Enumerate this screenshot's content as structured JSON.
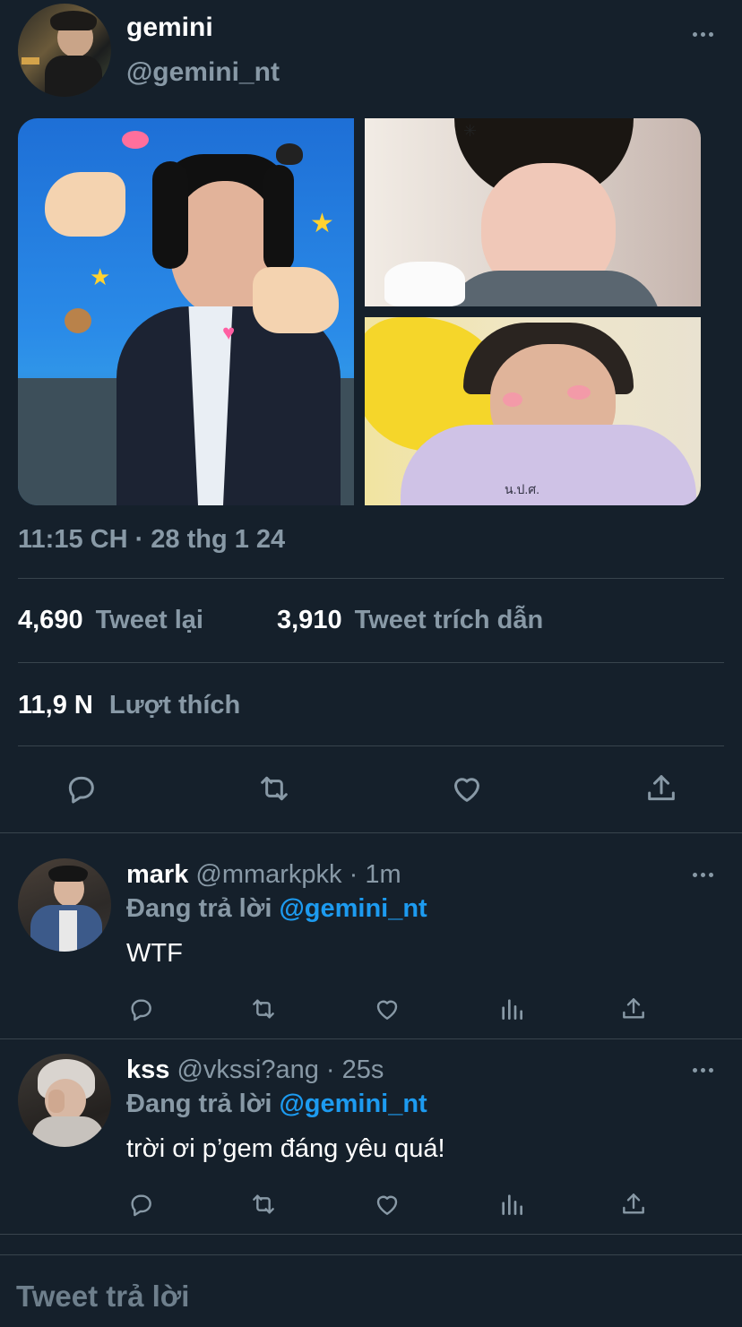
{
  "tweet": {
    "author_name": "gemini",
    "author_handle": "@gemini_nt",
    "timestamp": "11:15 CH · 28 thg 1 24",
    "stats": {
      "retweets_count": "4,690",
      "retweets_label": "Tweet lại",
      "quotes_count": "3,910",
      "quotes_label": "Tweet trích dẫn",
      "likes_count": "11,9 N",
      "likes_label": "Lượt thích"
    },
    "photo_text": "น.ป.ศ."
  },
  "replies": [
    {
      "name": "mark",
      "handle_time": "@mmarkpkk · 1m",
      "replying_label": "Đang trả lời",
      "replying_to": "@gemini_nt",
      "text": "WTF"
    },
    {
      "name": "kss",
      "handle_time": "@vkssi?ang · 25s",
      "replying_label": "Đang trả lời",
      "replying_to": "@gemini_nt",
      "text": "trời ơi p’gem đáng yêu quá!"
    }
  ],
  "composer": {
    "placeholder": "Tweet trả lời"
  },
  "colors": {
    "background": "#15202b",
    "muted": "#8899a6",
    "link": "#1d9bf0",
    "divider": "#38444d"
  },
  "icons": [
    "reply-icon",
    "retweet-icon",
    "like-icon",
    "share-icon",
    "analytics-icon",
    "more-icon"
  ]
}
